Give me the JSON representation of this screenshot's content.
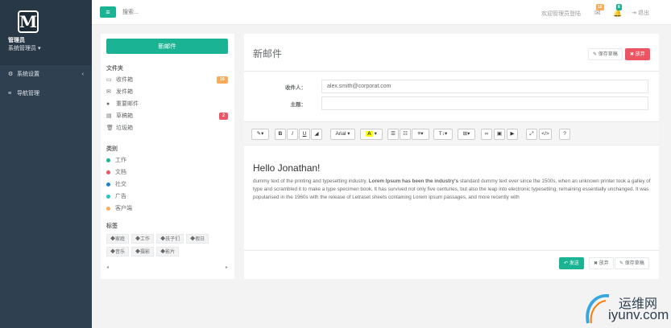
{
  "sidebar": {
    "logo_letter": "M",
    "admin_name": "管理员",
    "admin_role": "系统管理员 ▾",
    "items": [
      {
        "label": "系统设置",
        "icon": "gear-icon"
      },
      {
        "label": "导航管理",
        "icon": "list-icon"
      }
    ]
  },
  "topbar": {
    "search_placeholder": "搜索...",
    "welcome": "欢迎管理员登陆",
    "mail_count": "16",
    "alert_count": "8",
    "logout": "退出"
  },
  "mailbox": {
    "compose_label": "新邮件",
    "folders_title": "文件夹",
    "folders": [
      {
        "label": "收件箱",
        "icon": "inbox-icon",
        "badge": "16",
        "badge_color": "#f8ac59"
      },
      {
        "label": "发件箱",
        "icon": "envelope-icon",
        "badge": "",
        "badge_color": ""
      },
      {
        "label": "重要邮件",
        "icon": "certificate-icon",
        "badge": "",
        "badge_color": ""
      },
      {
        "label": "草稿箱",
        "icon": "file-icon",
        "badge": "2",
        "badge_color": "#ed5565"
      },
      {
        "label": "垃圾箱",
        "icon": "trash-icon",
        "badge": "",
        "badge_color": ""
      }
    ],
    "categories_title": "类别",
    "categories": [
      {
        "label": "工作",
        "color": "#1ab394"
      },
      {
        "label": "文档",
        "color": "#ed5565"
      },
      {
        "label": "社交",
        "color": "#1c84c6"
      },
      {
        "label": "广告",
        "color": "#23c6c8"
      },
      {
        "label": "客户端",
        "color": "#f8ac59"
      }
    ],
    "tags_title": "标签",
    "tags": [
      "家庭",
      "工作",
      "孩子们",
      "假日",
      "音乐",
      "摄影",
      "影片"
    ]
  },
  "compose": {
    "title": "新邮件",
    "save_draft": "保存草稿",
    "discard": "放弃",
    "to_label": "收件人：",
    "to_value": "alex.smith@corporat.com",
    "subject_label": "主题：",
    "subject_value": "",
    "font_name": "Arial",
    "body_heading": "Hello Jonathan!",
    "body_text_1": "dummy text of the printing and typesetting industry. ",
    "body_bold": "Lorem Ipsum has been the industry's",
    "body_text_2": " standard dummy text ever since the 1500s, when an unknown printer took a galley of type and scrambled it to make a type specimen book. It has survived not only five centuries, but also the leap into electronic typesetting, remaining essentially unchanged. It was popularised in the 1960s with the release of Letraset sheets containing Lorem Ipsum passages, and more recently with",
    "send": "发送",
    "bottom_discard": "放弃",
    "bottom_save_draft": "保存草稿"
  },
  "watermark": {
    "cn": "运维网",
    "en": "iyunv.com"
  }
}
